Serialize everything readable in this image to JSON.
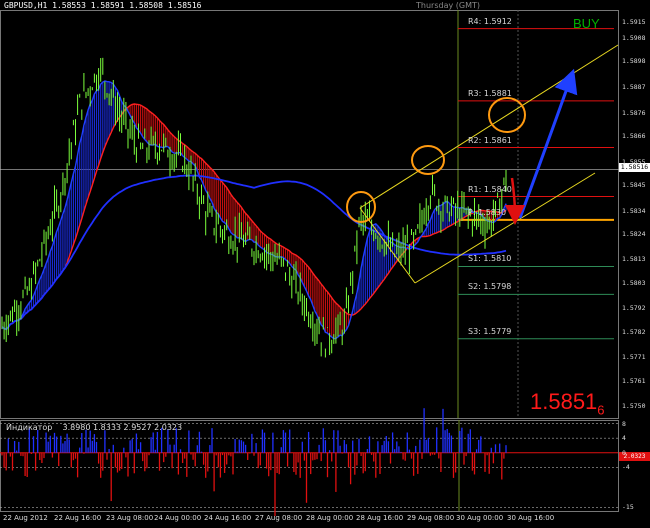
{
  "window": {
    "symbol_line": "GBPUSD,H1  1.58553 1.58591 1.58508 1.58516",
    "session_label": "Thursday  (GMT)"
  },
  "signal": {
    "label": "BUY",
    "color": "#00a000"
  },
  "current_price": {
    "main": "1.5851",
    "pip": "6",
    "axis_label": "1.58516"
  },
  "pivots": [
    {
      "label": "R4:",
      "value": "1.5912",
      "color": "#e01010"
    },
    {
      "label": "R3:",
      "value": "1.5881",
      "color": "#e01010"
    },
    {
      "label": "R2:",
      "value": "1.5861",
      "color": "#e01010"
    },
    {
      "label": "R1:",
      "value": "1.5840",
      "color": "#e01010"
    },
    {
      "label": "P:",
      "value": "1.5830",
      "color": "#ffa500"
    },
    {
      "label": "S1:",
      "value": "1.5810",
      "color": "#2e8b57"
    },
    {
      "label": "S2:",
      "value": "1.5798",
      "color": "#2e8b57"
    },
    {
      "label": "S3:",
      "value": "1.5779",
      "color": "#2e8b57"
    }
  ],
  "price_axis": [
    "1.5915",
    "1.5908",
    "1.5898",
    "1.5887",
    "1.5876",
    "1.5866",
    "1.5855",
    "1.5845",
    "1.5834",
    "1.5824",
    "1.5813",
    "1.5803",
    "1.5792",
    "1.5782",
    "1.5771",
    "1.5761",
    "1.5750"
  ],
  "time_axis": [
    "22 Aug 2012",
    "22 Aug 16:00",
    "23 Aug 08:00",
    "24 Aug 00:00",
    "24 Aug 16:00",
    "27 Aug 08:00",
    "28 Aug 00:00",
    "28 Aug 16:00",
    "29 Aug 08:00",
    "30 Aug 00:00",
    "30 Aug 16:00"
  ],
  "indicator": {
    "title": "Индикатор",
    "values": "3.8980 1.8333 2.9527 2.0323",
    "axis": [
      "8",
      "4",
      "0",
      "-4",
      "-15"
    ],
    "current_value": "2.0323"
  },
  "chart_data": {
    "type": "candlestick",
    "title": "GBPUSD,H1",
    "ylim": [
      1.5745,
      1.592
    ],
    "x": [
      "22 Aug 2012",
      "22 Aug 16:00",
      "23 Aug 08:00",
      "24 Aug 00:00",
      "24 Aug 16:00",
      "27 Aug 08:00",
      "28 Aug 00:00",
      "28 Aug 16:00",
      "29 Aug 08:00",
      "30 Aug 00:00",
      "30 Aug 16:00"
    ],
    "series": [
      {
        "name": "close",
        "values": [
          1.579,
          1.587,
          1.5885,
          1.584,
          1.5815,
          1.58,
          1.5778,
          1.5832,
          1.5842,
          1.5828,
          1.5852
        ]
      }
    ],
    "last": {
      "open": 1.58553,
      "high": 1.58591,
      "low": 1.58508,
      "close": 1.58516
    }
  }
}
